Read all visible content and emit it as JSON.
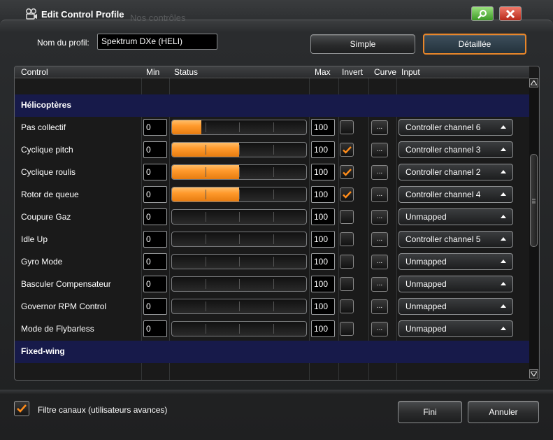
{
  "window": {
    "title": "Edit Control Profile",
    "ghost_text": "Nos contrôles"
  },
  "profile": {
    "label": "Nom du profil:",
    "value": "Spektrum DXe (HELI)"
  },
  "modes": {
    "simple": "Simple",
    "detailed": "Détaillée"
  },
  "columns": {
    "control": "Control",
    "min": "Min",
    "status": "Status",
    "max": "Max",
    "invert": "Invert",
    "curve": "Curve",
    "input": "Input"
  },
  "sections": {
    "helicopters": "Hélicoptères",
    "fixed_wing": "Fixed-wing"
  },
  "rows": [
    {
      "name": "Pas collectif",
      "min": "0",
      "max": "100",
      "status_level": 0.22,
      "inverted": false,
      "curve": "...",
      "input": "Controller channel 6"
    },
    {
      "name": "Cyclique pitch",
      "min": "0",
      "max": "100",
      "status_level": 0.5,
      "inverted": true,
      "curve": "...",
      "input": "Controller channel 3"
    },
    {
      "name": "Cyclique roulis",
      "min": "0",
      "max": "100",
      "status_level": 0.5,
      "inverted": true,
      "curve": "...",
      "input": "Controller channel 2"
    },
    {
      "name": "Rotor de queue",
      "min": "0",
      "max": "100",
      "status_level": 0.5,
      "inverted": true,
      "curve": "...",
      "input": "Controller channel 4"
    },
    {
      "name": "Coupure Gaz",
      "min": "0",
      "max": "100",
      "status_level": 0,
      "inverted": false,
      "curve": "...",
      "input": "Unmapped"
    },
    {
      "name": "Idle Up",
      "min": "0",
      "max": "100",
      "status_level": 0,
      "inverted": false,
      "curve": "...",
      "input": "Controller channel 5"
    },
    {
      "name": "Gyro Mode",
      "min": "0",
      "max": "100",
      "status_level": 0,
      "inverted": false,
      "curve": "...",
      "input": "Unmapped"
    },
    {
      "name": "Basculer Compensateur",
      "min": "0",
      "max": "100",
      "status_level": 0,
      "inverted": false,
      "curve": "...",
      "input": "Unmapped"
    },
    {
      "name": "Governor RPM Control",
      "min": "0",
      "max": "100",
      "status_level": 0,
      "inverted": false,
      "curve": "...",
      "input": "Unmapped"
    },
    {
      "name": "Mode de Flybarless",
      "min": "0",
      "max": "100",
      "status_level": 0,
      "inverted": false,
      "curve": "...",
      "input": "Unmapped"
    }
  ],
  "footer": {
    "filter_label": "Filtre canaux (utilisateurs avances)",
    "filter_checked": true,
    "done": "Fini",
    "cancel": "Annuler"
  },
  "colors": {
    "accent": "#ff9a2c",
    "section_bg": "#171a4a",
    "check": "#ff8c1a"
  }
}
